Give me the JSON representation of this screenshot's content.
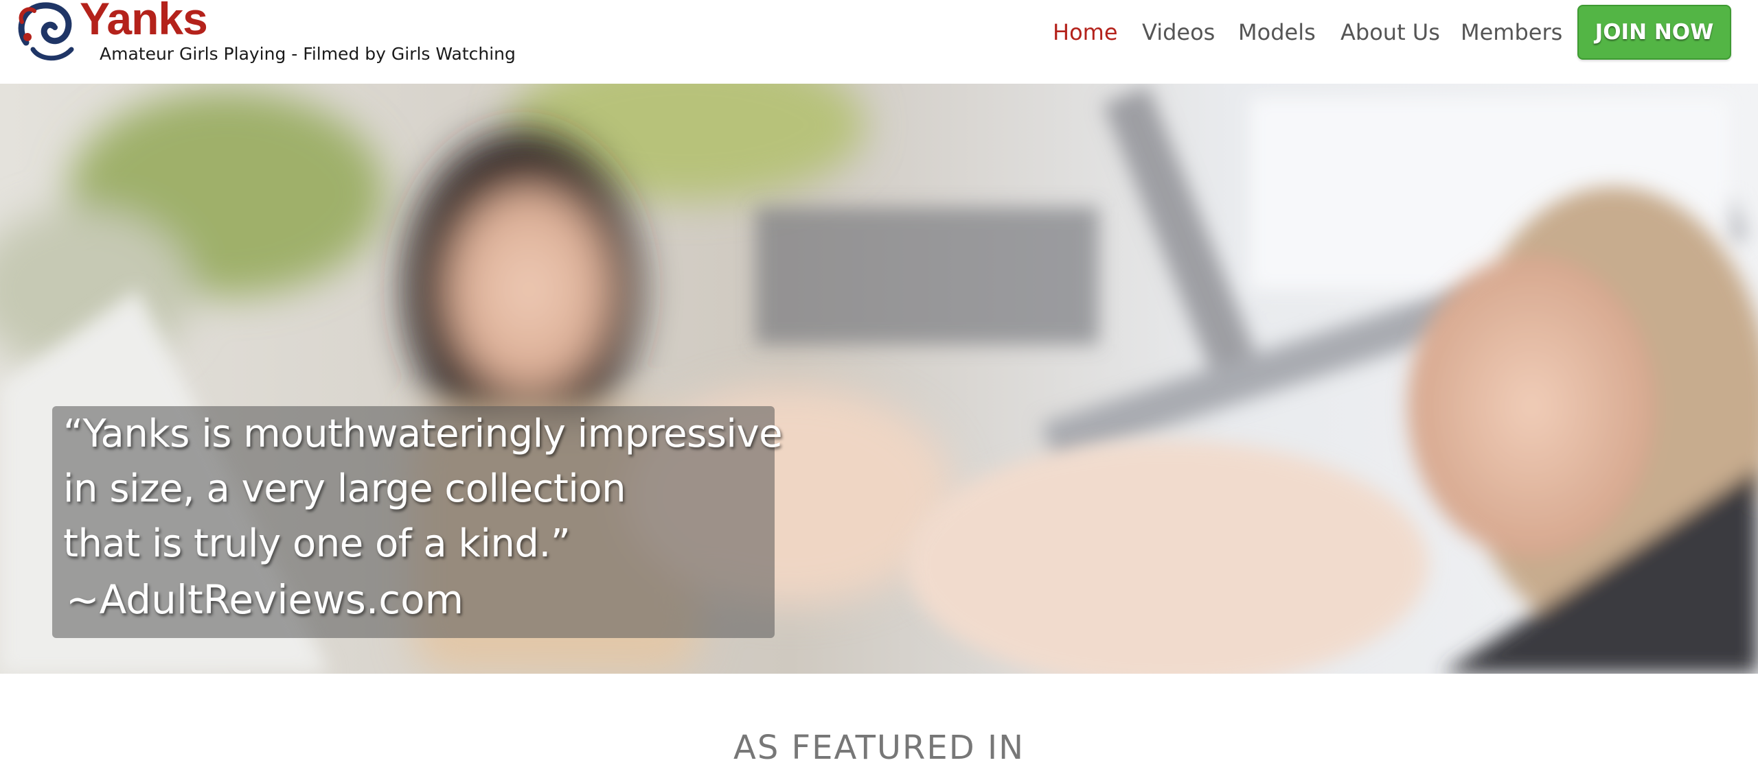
{
  "brand": {
    "name": "Yanks",
    "tagline": "Amateur Girls Playing - Filmed by Girls Watching",
    "color": "#b4221b"
  },
  "nav": {
    "items": [
      {
        "label": "Home",
        "active": true
      },
      {
        "label": "Videos",
        "active": false
      },
      {
        "label": "Models",
        "active": false
      },
      {
        "label": "About Us",
        "active": false
      },
      {
        "label": "Members",
        "active": false
      }
    ],
    "join_label": "JOIN NOW",
    "active_color": "#b4221b",
    "join_color": "#53b545"
  },
  "hero": {
    "quote_lines": [
      "“Yanks is mouthwateringly impressive",
      "in size, a very large collection",
      "that is truly one of a kind.”"
    ],
    "source": "~AdultReviews.com"
  },
  "featured": {
    "title": "AS FEATURED IN"
  }
}
